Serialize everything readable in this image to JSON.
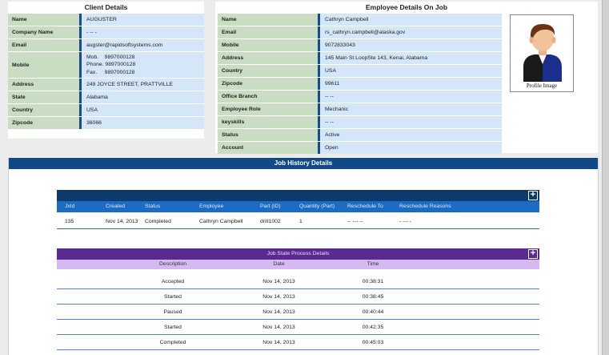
{
  "client": {
    "title": "Client Details",
    "rows": [
      {
        "label": "Name",
        "value": "AUGUSTER"
      },
      {
        "label": "Company Name",
        "value": "- -- -"
      },
      {
        "label": "Email",
        "value": "augster@rapidsoftsystems.com"
      },
      {
        "label": "Mobile",
        "lines": [
          "Mob.    9897000128",
          "Phone. 9897000128",
          "Fax.     9897000128"
        ]
      },
      {
        "label": "Address",
        "value": "249 JOYCE STREET, PRATTVILLE"
      },
      {
        "label": "State",
        "value": "Alabama"
      },
      {
        "label": "Country",
        "value": "USA"
      },
      {
        "label": "Zipcode",
        "value": "36066"
      }
    ]
  },
  "employee": {
    "title": "Employee Details On Job",
    "rows": [
      {
        "label": "Name",
        "value": "Cathryn Campbell"
      },
      {
        "label": "Email",
        "value": "rs_cathryn.campbell@alaska.gov"
      },
      {
        "label": "Mobile",
        "value": "9072833043"
      },
      {
        "label": "Address",
        "value": "145 Main St LoopSte 143, Kenai, Alabama"
      },
      {
        "label": "Country",
        "value": "USA"
      },
      {
        "label": "Zipcode",
        "value": "99611"
      },
      {
        "label": "Office Branch",
        "value": "-- --"
      },
      {
        "label": "Employee Role",
        "value": "Mechanic"
      },
      {
        "label": "keyskills",
        "value": "-- --"
      },
      {
        "label": "Status",
        "value": "Active"
      },
      {
        "label": "Account",
        "value": "Open"
      }
    ],
    "profile_caption": "Profile Image"
  },
  "history": {
    "title": "Job History Details",
    "expand_label": "+",
    "columns": [
      "JxId",
      "Created",
      "Status",
      "Employee",
      "Part (ID)",
      "Quantity (Part)",
      "Reschedule To",
      "Reschedule Reasons"
    ],
    "rows": [
      [
        "135",
        "Nov 14, 2013",
        "Completed",
        "Cathryn Campbell",
        "drill1002",
        "1",
        "-- --- --",
        "- --- -"
      ]
    ]
  },
  "states": {
    "title": "Job State Process Details",
    "expand_label": "+",
    "columns": [
      "Description",
      "Date",
      "Time"
    ],
    "rows": [
      [
        "Accepted",
        "Nov 14, 2013",
        "00:38:31"
      ],
      [
        "Started",
        "Nov 14, 2013",
        "00:38:45"
      ],
      [
        "Paused",
        "Nov 14, 2013",
        "00:40:44"
      ],
      [
        "Started",
        "Nov 14, 2013",
        "00:42:35"
      ],
      [
        "Completed",
        "Nov 14, 2013",
        "00:45:03"
      ]
    ]
  },
  "colors": {
    "label_bg": "#c9ddc3",
    "value_bg": "#d4e7f8",
    "history_header": "#0f4a86",
    "state_header": "#5b2a91",
    "state_columns": "#d7b9f2"
  },
  "icons": [
    "user-avatar-icon",
    "plus-icon"
  ]
}
